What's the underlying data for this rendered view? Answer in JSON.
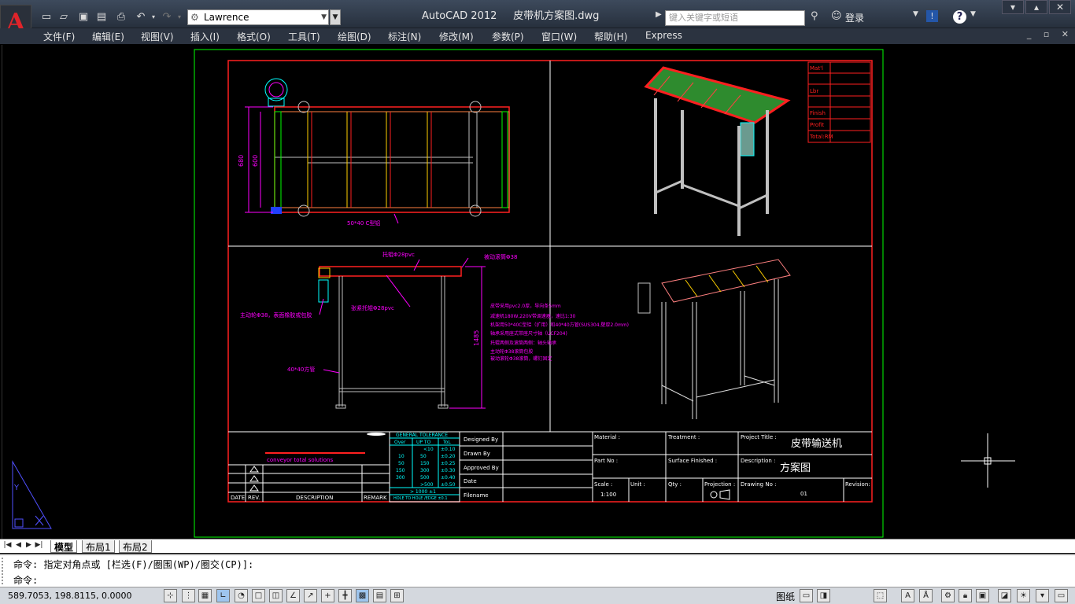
{
  "titlebar": {
    "app_title": "AutoCAD 2012",
    "file_name": "皮带机方案图.dwg",
    "workspace": "Lawrence",
    "search_placeholder": "键入关键字或短语",
    "login": "登录"
  },
  "menus": [
    "文件(F)",
    "编辑(E)",
    "视图(V)",
    "插入(I)",
    "格式(O)",
    "工具(T)",
    "绘图(D)",
    "标注(N)",
    "修改(M)",
    "参数(P)",
    "窗口(W)",
    "帮助(H)",
    "Express"
  ],
  "layout_tabs": [
    "模型",
    "布局1",
    "布局2"
  ],
  "command": {
    "history": "命令: 指定对角点或 [栏选(F)/圈围(WP)/圈交(CP)]:",
    "prompt": "命令:"
  },
  "status": {
    "coords": "589.7053, 198.8115, 0.0000",
    "paper": "图纸"
  },
  "drawing": {
    "dims": {
      "d680": "680",
      "d600": "600",
      "d1485": "1485"
    },
    "plan_label": "50*40 C型铝",
    "side_labels": {
      "a": "托辊Φ28pvc",
      "b": "被动滚筒Φ38",
      "c": "张紧托辊Φ28pvc",
      "d": "主动轮Φ38，表面橡胶或包胶",
      "e": "40*40方管"
    },
    "notes": [
      "皮带采用pvc2.0厚，导向条5mm",
      "减速机180W,220V带调速器，速比1:30",
      "机架用50*40C型铝（扩用）和40*40方管(SUS304,壁厚2.0mm)",
      "轴承采用座式带座尺寸轴（UCF204)",
      "托辊两侧及滚筒两侧：轴头轴承",
      "主动轮Φ38滚筒包胶",
      "被动滚轮Φ38滚筒，螺钉固定"
    ],
    "bom": [
      "Mat'l",
      "Lbr",
      "Finish",
      "Profit",
      "Total:RM"
    ],
    "tolerance": {
      "title": "GENERAL TOLERANCE",
      "headers": [
        "Over",
        "UP TO",
        "ToL"
      ],
      "rows": [
        [
          "",
          "<10",
          "±0.10"
        ],
        [
          "10",
          "50",
          "±0.20"
        ],
        [
          "50",
          "150",
          "±0.25"
        ],
        [
          "150",
          "300",
          "±0.30"
        ],
        [
          "300",
          "500",
          "±0.40"
        ],
        [
          "",
          ">500",
          "±0.50"
        ]
      ],
      "extra": "> 1000 ±1",
      "footer": "HOLE TO HOLE /EDGE ±0.1"
    },
    "company": "conveyor total solutions",
    "rev_headers": [
      "DATE",
      "REV.",
      "DESCRIPTION",
      "REMARK"
    ],
    "sign_rows": [
      "Designed By",
      "Drawn By",
      "Approved By",
      "Date",
      "Filename"
    ],
    "fields": {
      "material": "Material :",
      "treatment": "Treatment :",
      "project_title_label": "Project Title :",
      "project_title": "皮带输送机",
      "part_no": "Part No :",
      "surface": "Surface Finished :",
      "description_label": "Description :",
      "description": "方案图",
      "scale_label": "Scale :",
      "scale": "1:100",
      "unit": "Unit :",
      "qty": "Qty :",
      "projection": "Projection :",
      "drawing_no_label": "Drawing No :",
      "drawing_no": "01",
      "revision": "Revision:"
    },
    "colors": {
      "border": "#ff2020",
      "dim": "#ff00ff",
      "text": "#ffffff",
      "label": "#ff00ff",
      "belt": "#2e8b2e",
      "frame": "#c0c0c0",
      "cyan": "#00ffff",
      "green": "#00ff00"
    }
  }
}
